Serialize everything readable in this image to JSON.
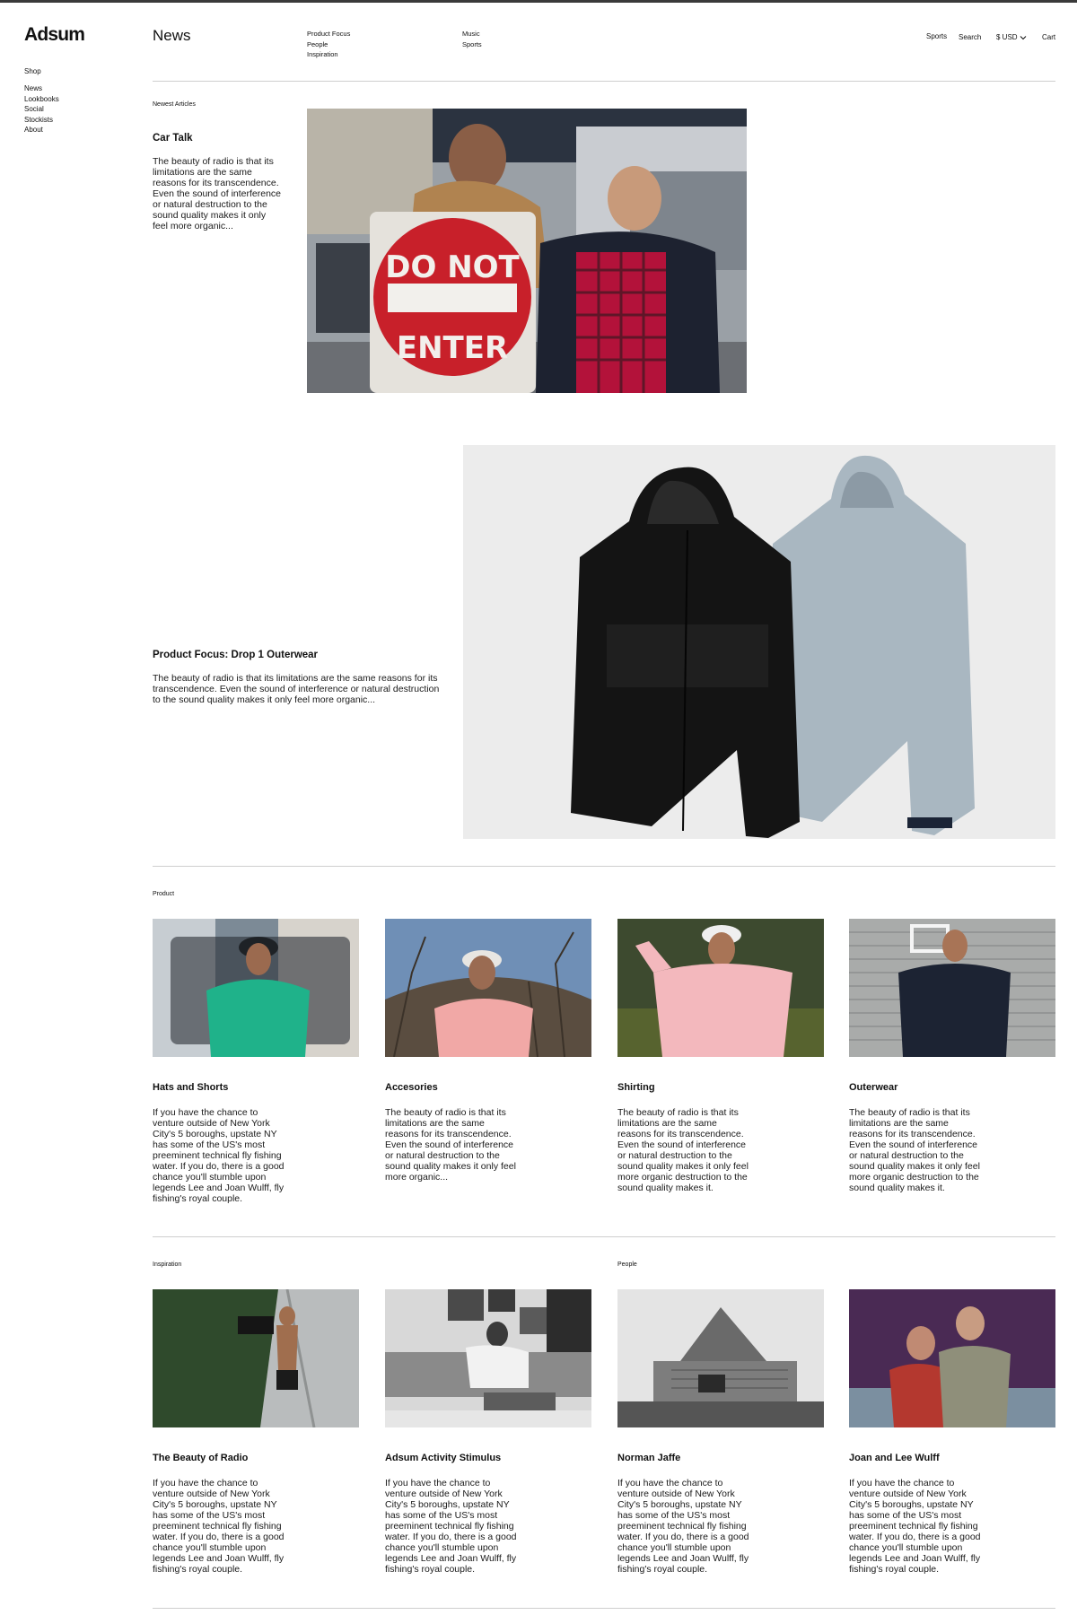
{
  "brand": {
    "logo": "Adsum"
  },
  "sidebar": {
    "shop_label": "Shop",
    "items": [
      "News",
      "Lookbooks",
      "Social",
      "Stockists",
      "About"
    ]
  },
  "header": {
    "title": "News",
    "categories_col1": [
      "Product Focus",
      "People",
      "Inspiration"
    ],
    "categories_col2": [
      "Music",
      "Sports"
    ],
    "utility": {
      "sports": "Sports",
      "search": "Search",
      "currency": "$ USD",
      "cart": "Cart"
    }
  },
  "newest": {
    "label": "Newest Articles",
    "title": "Car Talk",
    "text": "The beauty of radio is that its limitations are the same reasons for its transcendence. Even the sound of interference or natural destruction to the sound quality makes it only feel more organic...",
    "photo_sign_top": "DO NOT",
    "photo_sign_bottom": "ENTER"
  },
  "feature": {
    "title": "Product Focus: Drop 1 Outerwear",
    "text": "The beauty of radio is that its limitations are the same reasons for its transcendence. Even the sound of interference or natural destruction to the sound quality makes it only feel more organic..."
  },
  "product_section": {
    "label": "Product",
    "cards": [
      {
        "title": "Hats and Shorts",
        "text": "If you have the chance to venture outside of New York City's 5 boroughs, upstate NY has some of the US's most preeminent technical fly fishing water. If you do, there is a good chance you'll stumble upon legends Lee and Joan Wulff, fly fishing's royal couple."
      },
      {
        "title": "Accesories",
        "text": "The beauty of radio is that its limitations are the same reasons for its transcendence. Even the sound of interference or natural destruction to the sound quality makes it only feel more organic..."
      },
      {
        "title": "Shirting",
        "text": "The beauty of radio is that its limitations are the same reasons for its transcendence. Even the sound of interference or natural destruction to the sound quality makes it only feel more organic destruction to the sound quality makes it."
      },
      {
        "title": "Outerwear",
        "text": "The beauty of radio is that its limitations are the same reasons for its transcendence. Even the sound of interference or natural destruction to the sound quality makes it only feel more organic destruction to the sound quality makes it."
      }
    ]
  },
  "inspiration_section": {
    "label": "Inspiration"
  },
  "people_section": {
    "label": "People"
  },
  "bottom_cards": [
    {
      "title": "The Beauty of Radio",
      "text": "If you have the chance to venture outside of New York City's 5 boroughs, upstate NY has some of the US's most preeminent technical fly fishing water. If you do, there is a good chance you'll stumble upon legends Lee and Joan Wulff, fly fishing's royal couple."
    },
    {
      "title": "Adsum Activity Stimulus",
      "text": "If you have the chance to venture outside of New York City's 5 boroughs, upstate NY has some of the US's most preeminent technical fly fishing water. If you do, there is a good chance you'll stumble upon legends Lee and Joan Wulff, fly fishing's royal couple."
    },
    {
      "title": "Norman Jaffe",
      "text": "If you have the chance to venture outside of New York City's 5 boroughs, upstate NY has some of the US's most preeminent technical fly fishing water. If you do, there is a good chance you'll stumble upon legends Lee and Joan Wulff, fly fishing's royal couple."
    },
    {
      "title": "Joan and Lee Wulff",
      "text": "If you have the chance to venture outside of New York City's 5 boroughs, upstate NY has some of the US's most preeminent technical fly fishing water. If you do, there is a good chance you'll stumble upon legends Lee and Joan Wulff, fly fishing's royal couple."
    }
  ],
  "colors": {
    "rule": "#cfcfcf",
    "feature_bg": "#ececec",
    "text": "#111111"
  }
}
